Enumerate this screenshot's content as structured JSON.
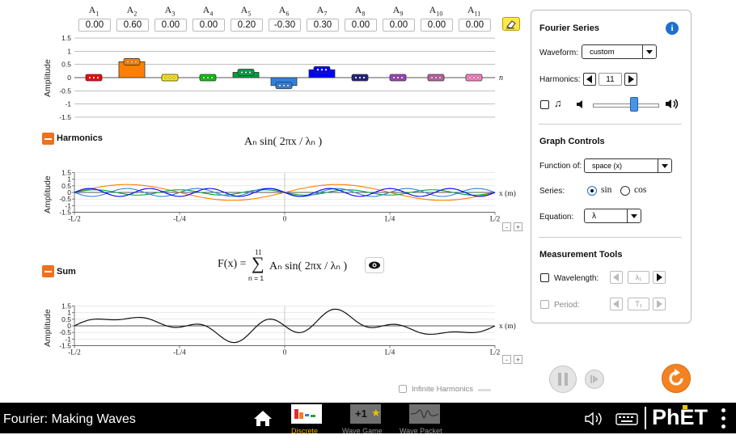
{
  "amplitudes": {
    "labels": [
      {
        "base": "A",
        "sub": "1"
      },
      {
        "base": "A",
        "sub": "2"
      },
      {
        "base": "A",
        "sub": "3"
      },
      {
        "base": "A",
        "sub": "4"
      },
      {
        "base": "A",
        "sub": "5"
      },
      {
        "base": "A",
        "sub": "6"
      },
      {
        "base": "A",
        "sub": "7"
      },
      {
        "base": "A",
        "sub": "8"
      },
      {
        "base": "A",
        "sub": "9"
      },
      {
        "base": "A",
        "sub": "10"
      },
      {
        "base": "A",
        "sub": "11"
      }
    ],
    "values": [
      "0.00",
      "0.60",
      "0.00",
      "0.00",
      "0.20",
      "-0.30",
      "0.30",
      "0.00",
      "0.00",
      "0.00",
      "0.00"
    ],
    "numeric": [
      0,
      0.6,
      0,
      0,
      0.2,
      -0.3,
      0.3,
      0,
      0,
      0,
      0
    ],
    "colors": [
      "#ff0000",
      "#ff8000",
      "#ffe600",
      "#00c800",
      "#00a040",
      "#3080e0",
      "#0000ff",
      "#202080",
      "#a040c0",
      "#c060a0",
      "#ff7fbf"
    ],
    "y_ticks": [
      "1.5",
      "1",
      "0.5",
      "0",
      "-0.5",
      "-1",
      "-1.5"
    ],
    "y_axis_label": "Amplitude",
    "x_axis_label": "n"
  },
  "harmonics": {
    "toggle_label": "Harmonics",
    "equation": "Aₙ sin( 2πx / λₙ )",
    "y_ticks": [
      "1.5",
      "1",
      "0.5",
      "0",
      "-0.5",
      "-1",
      "-1.5"
    ],
    "x_ticks": [
      "-L/2",
      "-L/4",
      "0",
      "L/4",
      "L/2"
    ],
    "y_axis_label": "Amplitude",
    "x_axis_label": "x (m)"
  },
  "sum": {
    "toggle_label": "Sum",
    "equation_prefix": "F(x) =",
    "sigma_top": "11",
    "sigma_bottom": "n = 1",
    "equation_body": "Aₙ sin( 2πx / λₙ )",
    "y_ticks": [
      "1.5",
      "1",
      "0.5",
      "0",
      "-0.5",
      "-1",
      "-1.5"
    ],
    "x_ticks": [
      "-L/2",
      "-L/4",
      "0",
      "L/4",
      "L/2"
    ],
    "y_axis_label": "Amplitude",
    "x_axis_label": "x (m)",
    "infinite_harmonics_label": "Infinite Harmonics"
  },
  "zoom": {
    "minus": "-",
    "plus": "+"
  },
  "panel": {
    "fourier_title": "Fourier Series",
    "waveform_label": "Waveform:",
    "waveform_value": "custom",
    "harmonics_label": "Harmonics:",
    "harmonics_value": "11",
    "graph_controls_title": "Graph Controls",
    "function_of_label": "Function of:",
    "function_of_value": "space (x)",
    "series_label": "Series:",
    "series_sin": "sin",
    "series_cos": "cos",
    "equation_label": "Equation:",
    "equation_value": "λ",
    "measurement_title": "Measurement Tools",
    "wavelength_label": "Wavelength:",
    "wavelength_tool": "λ₁",
    "period_label": "Period:",
    "period_tool": "T₁"
  },
  "navbar": {
    "title": "Fourier: Making Waves",
    "tabs": [
      {
        "label": "Discrete",
        "active": true
      },
      {
        "label": "Wave Game",
        "active": false
      },
      {
        "label": "Wave Packet",
        "active": false
      }
    ],
    "brand": "PhET",
    "wave_game_badge": "+1"
  }
}
